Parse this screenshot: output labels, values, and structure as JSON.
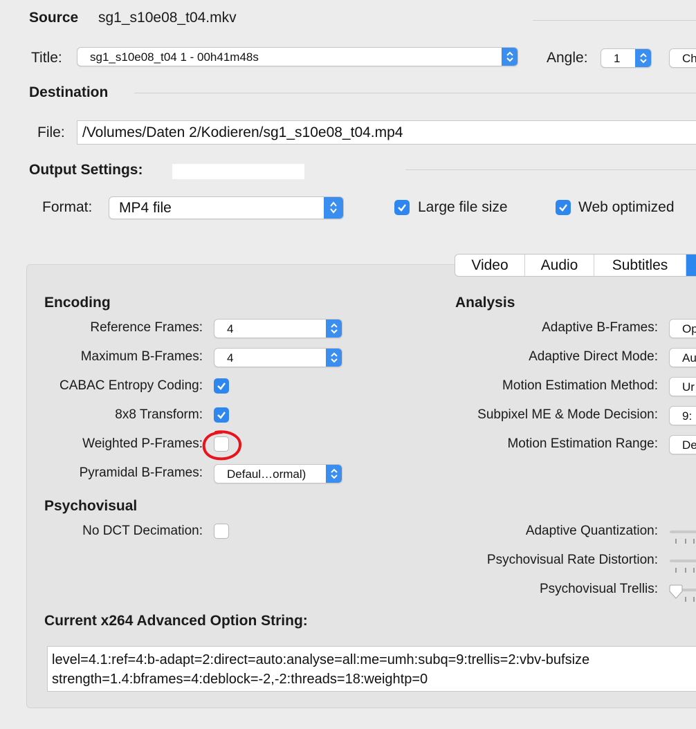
{
  "source": {
    "label": "Source",
    "filename": "sg1_s10e08_t04.mkv"
  },
  "title_row": {
    "label": "Title:",
    "value": "sg1_s10e08_t04 1 - 00h41m48s",
    "angle_label": "Angle:",
    "angle_value": "1",
    "chapters_partial": "Ch"
  },
  "destination": {
    "label": "Destination",
    "file_label": "File:",
    "file_path": "/Volumes/Daten 2/Kodieren/sg1_s10e08_t04.mp4"
  },
  "output": {
    "label": "Output Settings:",
    "format_label": "Format:",
    "format_value": "MP4 file",
    "large_file_label": "Large file size",
    "large_file_checked": true,
    "web_optimized_label": "Web optimized",
    "web_optimized_checked": true
  },
  "tabs": [
    {
      "label": "Video",
      "selected": false
    },
    {
      "label": "Audio",
      "selected": false
    },
    {
      "label": "Subtitles",
      "selected": false
    },
    {
      "label": "",
      "selected": true
    }
  ],
  "encoding": {
    "heading": "Encoding",
    "reference_frames": {
      "label": "Reference Frames:",
      "value": "4"
    },
    "max_bframes": {
      "label": "Maximum B-Frames:",
      "value": "4"
    },
    "cabac": {
      "label": "CABAC Entropy Coding:",
      "checked": true
    },
    "transform8x8": {
      "label": "8x8 Transform:",
      "checked": true
    },
    "weighted_p": {
      "label": "Weighted P-Frames:",
      "checked": false
    },
    "pyramidal": {
      "label": "Pyramidal B-Frames:",
      "value": "Defaul…ormal)"
    }
  },
  "psychovisual": {
    "heading": "Psychovisual",
    "no_dct": {
      "label": "No DCT Decimation:",
      "checked": false
    }
  },
  "analysis": {
    "heading": "Analysis",
    "adaptive_b": {
      "label": "Adaptive B-Frames:",
      "value": "Op"
    },
    "direct_mode": {
      "label": "Adaptive Direct Mode:",
      "value": "Au"
    },
    "me_method": {
      "label": "Motion Estimation Method:",
      "value": "Ur"
    },
    "subpixel": {
      "label": "Subpixel ME & Mode Decision:",
      "value": "9:"
    },
    "me_range": {
      "label": "Motion Estimation Range:",
      "value": "De"
    },
    "adaptive_q": {
      "label": "Adaptive Quantization:"
    },
    "psy_rd": {
      "label": "Psychovisual Rate Distortion:"
    },
    "psy_trellis": {
      "label": "Psychovisual Trellis:"
    }
  },
  "option_string": {
    "label": "Current x264 Advanced Option String:",
    "line1": "level=4.1:ref=4:b-adapt=2:direct=auto:analyse=all:me=umh:subq=9:trellis=2:vbv-bufsize",
    "line2": "strength=1.4:bframes=4:deblock=-2,-2:threads=18:weightp=0"
  },
  "colors": {
    "accent": "#2e87ef",
    "annotation": "#e8141c"
  }
}
